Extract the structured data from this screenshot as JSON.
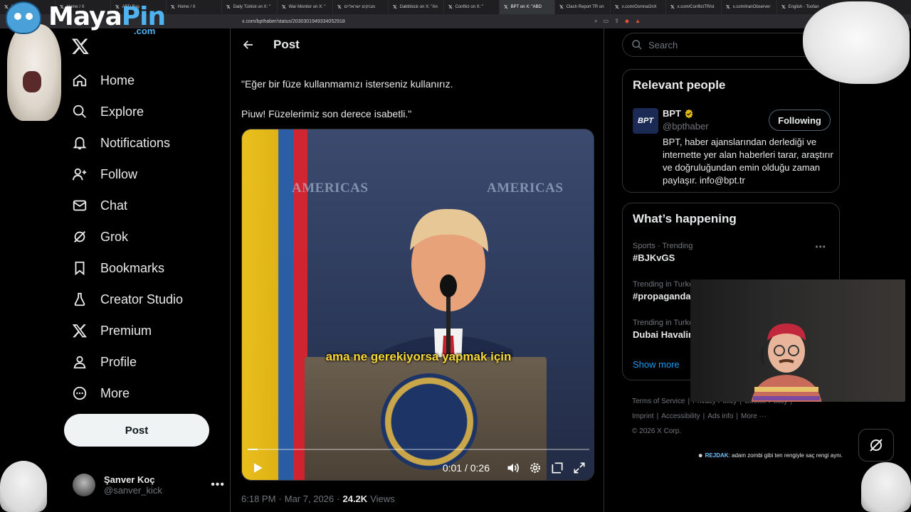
{
  "browser": {
    "tabs": [
      {
        "label": "Hom",
        "active": false
      },
      {
        "label": "Home / X",
        "active": false
      },
      {
        "label": "ABD Baş",
        "active": false
      },
      {
        "label": "Home / X",
        "active": false
      },
      {
        "label": "Daily Türkist on X: \"",
        "active": false
      },
      {
        "label": "War Monitor on X: \"",
        "active": false
      },
      {
        "label": "מבזקים ישראליים",
        "active": false
      },
      {
        "label": "Daktblock on X: \"An",
        "active": false
      },
      {
        "label": "Conflict on X: \"",
        "active": false
      },
      {
        "label": "BPT on X: \"ABD",
        "active": true
      },
      {
        "label": "Clash Report TR on",
        "active": false
      },
      {
        "label": "x.com/OsmnaOnX",
        "active": false
      },
      {
        "label": "x.com/ConflictTR/st",
        "active": false
      },
      {
        "label": "x.com/IranObserver",
        "active": false
      },
      {
        "label": "English - Toofan",
        "active": false
      }
    ],
    "url": "x.com/bpthaber/status/2030301949334052918"
  },
  "overlay_logo": {
    "text_a": "Maya",
    "text_b": "Pin",
    "suffix": ".com"
  },
  "sidebar": {
    "items": [
      {
        "label": "Home",
        "icon": "home-icon"
      },
      {
        "label": "Explore",
        "icon": "search-icon"
      },
      {
        "label": "Notifications",
        "icon": "bell-icon"
      },
      {
        "label": "Follow",
        "icon": "follow-icon"
      },
      {
        "label": "Chat",
        "icon": "mail-icon"
      },
      {
        "label": "Grok",
        "icon": "grok-icon"
      },
      {
        "label": "Bookmarks",
        "icon": "bookmark-icon"
      },
      {
        "label": "Creator Studio",
        "icon": "flask-icon"
      },
      {
        "label": "Premium",
        "icon": "x-premium-icon"
      },
      {
        "label": "Profile",
        "icon": "person-icon"
      },
      {
        "label": "More",
        "icon": "more-circle-icon"
      }
    ],
    "post_button": "Post",
    "profile": {
      "name": "Şanver Koç",
      "handle": "@sanver_kick",
      "more": "•••"
    }
  },
  "main": {
    "header_title": "Post",
    "tweet_lines": [
      "\"Eğer bir füze kullanmamızı isterseniz kullanırız.",
      "Piuw! Füzelerimiz son derece isabetli.\""
    ],
    "video": {
      "backdrop_text": "AMERICAS",
      "subtitle": "ama ne gerekiyorsa yapmak için",
      "time": "0:01 / 0:26",
      "progress_fraction": 0.03
    },
    "meta": {
      "time": "6:18 PM",
      "sep": "·",
      "date": "Mar 7, 2026",
      "views_count": "24.2K",
      "views_label": "Views"
    }
  },
  "right": {
    "search_placeholder": "Search",
    "relevant": {
      "title": "Relevant people",
      "avatar_text": "BPT",
      "name": "BPT",
      "handle": "@bpthaber",
      "button": "Following",
      "bio": "BPT, haber ajanslarından derlediği ve internette yer alan haberleri tarar, araştırır ve doğruluğundan emin olduğu zaman paylaşır. info@bpt.tr"
    },
    "happening": {
      "title": "What’s happening",
      "trends": [
        {
          "category": "Sports · Trending",
          "name": "#BJKvGS"
        },
        {
          "category": "Trending in Turkey",
          "name": "#propaganda"
        },
        {
          "category": "Trending in Turkey",
          "name": "Dubai Havalimanı"
        }
      ],
      "show_more": "Show more"
    },
    "footer": {
      "line1": [
        "Terms of Service",
        "|",
        "Privacy Policy",
        "|",
        "Cookie Policy",
        "|"
      ],
      "line2": [
        "Imprint",
        "|",
        "Accessibility",
        "|",
        "Ads info",
        "|",
        "More ···"
      ],
      "line3": "© 2026 X Corp."
    }
  },
  "chat_overlay": {
    "user": "REJDAK",
    "message": ": adam zombi gibi ten rengiyle saç rengi aynı."
  },
  "colors": {
    "background": "#000000",
    "text_primary": "#e7e9ea",
    "text_secondary": "#71767b",
    "accent_blue": "#1d9bf0",
    "border": "#2f3336",
    "subtitle_yellow": "#f5d73a"
  }
}
